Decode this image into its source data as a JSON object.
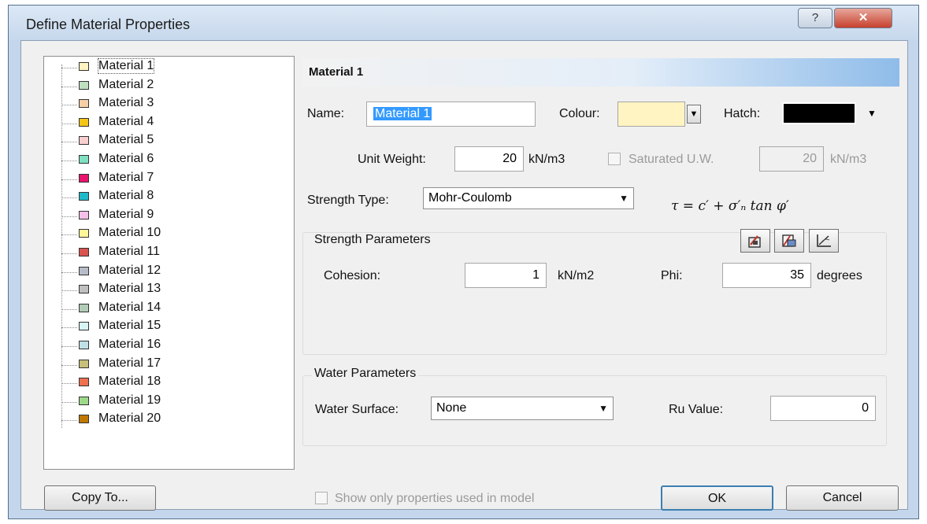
{
  "window": {
    "title": "Define Material Properties",
    "help_glyph": "?",
    "close_glyph": "✕"
  },
  "materials": [
    {
      "label": "Material 1",
      "color": "#fff4c2"
    },
    {
      "label": "Material 2",
      "color": "#bfe0bf"
    },
    {
      "label": "Material 3",
      "color": "#f7cfa6"
    },
    {
      "label": "Material 4",
      "color": "#f5c518"
    },
    {
      "label": "Material 5",
      "color": "#f9cfcf"
    },
    {
      "label": "Material 6",
      "color": "#7fe0c2"
    },
    {
      "label": "Material 7",
      "color": "#e8146e"
    },
    {
      "label": "Material 8",
      "color": "#1eb9c9"
    },
    {
      "label": "Material 9",
      "color": "#f4bfe8"
    },
    {
      "label": "Material 10",
      "color": "#fff69a"
    },
    {
      "label": "Material 11",
      "color": "#d9534f"
    },
    {
      "label": "Material 12",
      "color": "#b7bdc8"
    },
    {
      "label": "Material 13",
      "color": "#c0c0c0"
    },
    {
      "label": "Material 14",
      "color": "#b2ccb8"
    },
    {
      "label": "Material 15",
      "color": "#d8f4f4"
    },
    {
      "label": "Material 16",
      "color": "#bfe1e6"
    },
    {
      "label": "Material 17",
      "color": "#c7bf7a"
    },
    {
      "label": "Material 18",
      "color": "#f0714f"
    },
    {
      "label": "Material 19",
      "color": "#9ed98a"
    },
    {
      "label": "Material 20",
      "color": "#c07800"
    }
  ],
  "selected_index": 0,
  "header": {
    "title": "Material 1"
  },
  "name": {
    "label": "Name:",
    "value": "Material 1"
  },
  "colour": {
    "label": "Colour:",
    "value_color": "#fff4c2"
  },
  "hatch": {
    "label": "Hatch:",
    "value_color": "#000000"
  },
  "unit_weight": {
    "label": "Unit Weight:",
    "value": "20",
    "unit": "kN/m3"
  },
  "saturated": {
    "label": "Saturated U.W.",
    "value": "20",
    "unit": "kN/m3",
    "checked": false
  },
  "strength_type": {
    "label": "Strength Type:",
    "value": "Mohr-Coulomb",
    "formula": "τ = c′ + σ′ₙ tan φ′"
  },
  "strength_params": {
    "title": "Strength Parameters",
    "cohesion": {
      "label": "Cohesion:",
      "value": "1",
      "unit": "kN/m2"
    },
    "phi": {
      "label": "Phi:",
      "value": "35",
      "unit": "degrees"
    }
  },
  "water_params": {
    "title": "Water Parameters",
    "surface": {
      "label": "Water Surface:",
      "value": "None"
    },
    "ru": {
      "label": "Ru Value:",
      "value": "0"
    }
  },
  "footer": {
    "copy_to": "Copy To...",
    "show_only": "Show only properties used in model",
    "show_only_checked": false,
    "ok": "OK",
    "cancel": "Cancel"
  }
}
